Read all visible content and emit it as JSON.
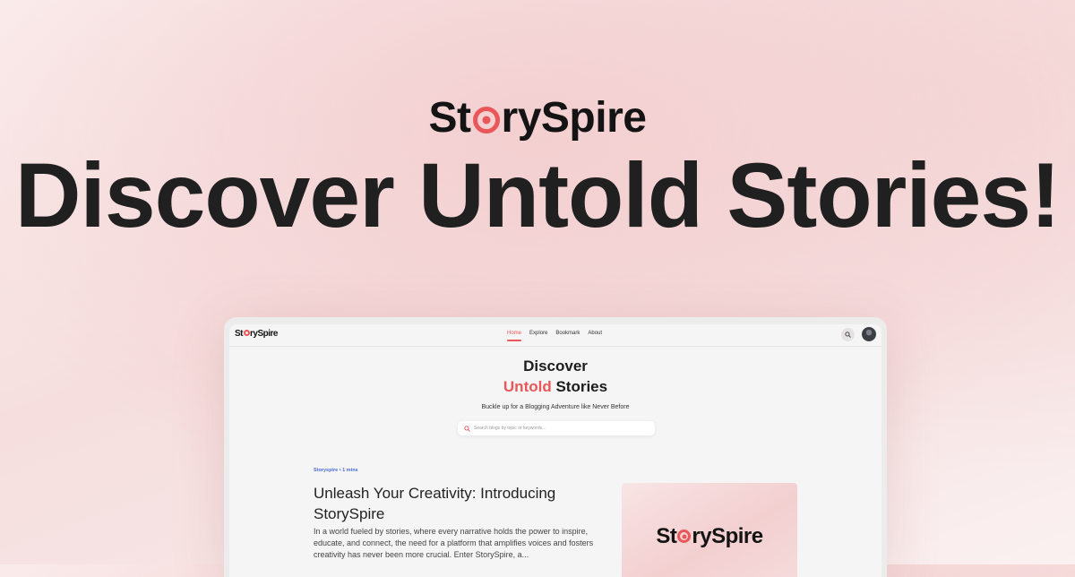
{
  "brand": {
    "prefix": "St",
    "suffix": "rySpire"
  },
  "hero": {
    "title": "Discover Untold Stories!"
  },
  "app": {
    "nav": {
      "links": [
        {
          "label": "Home",
          "active": true
        },
        {
          "label": "Explore",
          "active": false
        },
        {
          "label": "Bookmark",
          "active": false
        },
        {
          "label": "About",
          "active": false
        }
      ],
      "icons": [
        "search-icon",
        "user-avatar"
      ]
    },
    "hero": {
      "line1": "Discover",
      "accent": "Untold",
      "line2_rest": " Stories",
      "subtitle": "Buckle up for a Blogging Adventure like Never Before",
      "search_placeholder": "Search blogs by topic or keywords..."
    },
    "post": {
      "meta": "Storyspire • 1 mins",
      "title": "Unleash Your Creativity: Introducing StorySpire",
      "excerpt": "In a world fueled by stories, where every narrative holds the power to inspire, educate, and connect, the need for a platform that amplifies voices and fosters creativity has never been more crucial. Enter StorySpire, a..."
    }
  },
  "colors": {
    "accent": "#e9575a",
    "link_blue": "#4b6bd6",
    "text": "#1f1f1f"
  }
}
